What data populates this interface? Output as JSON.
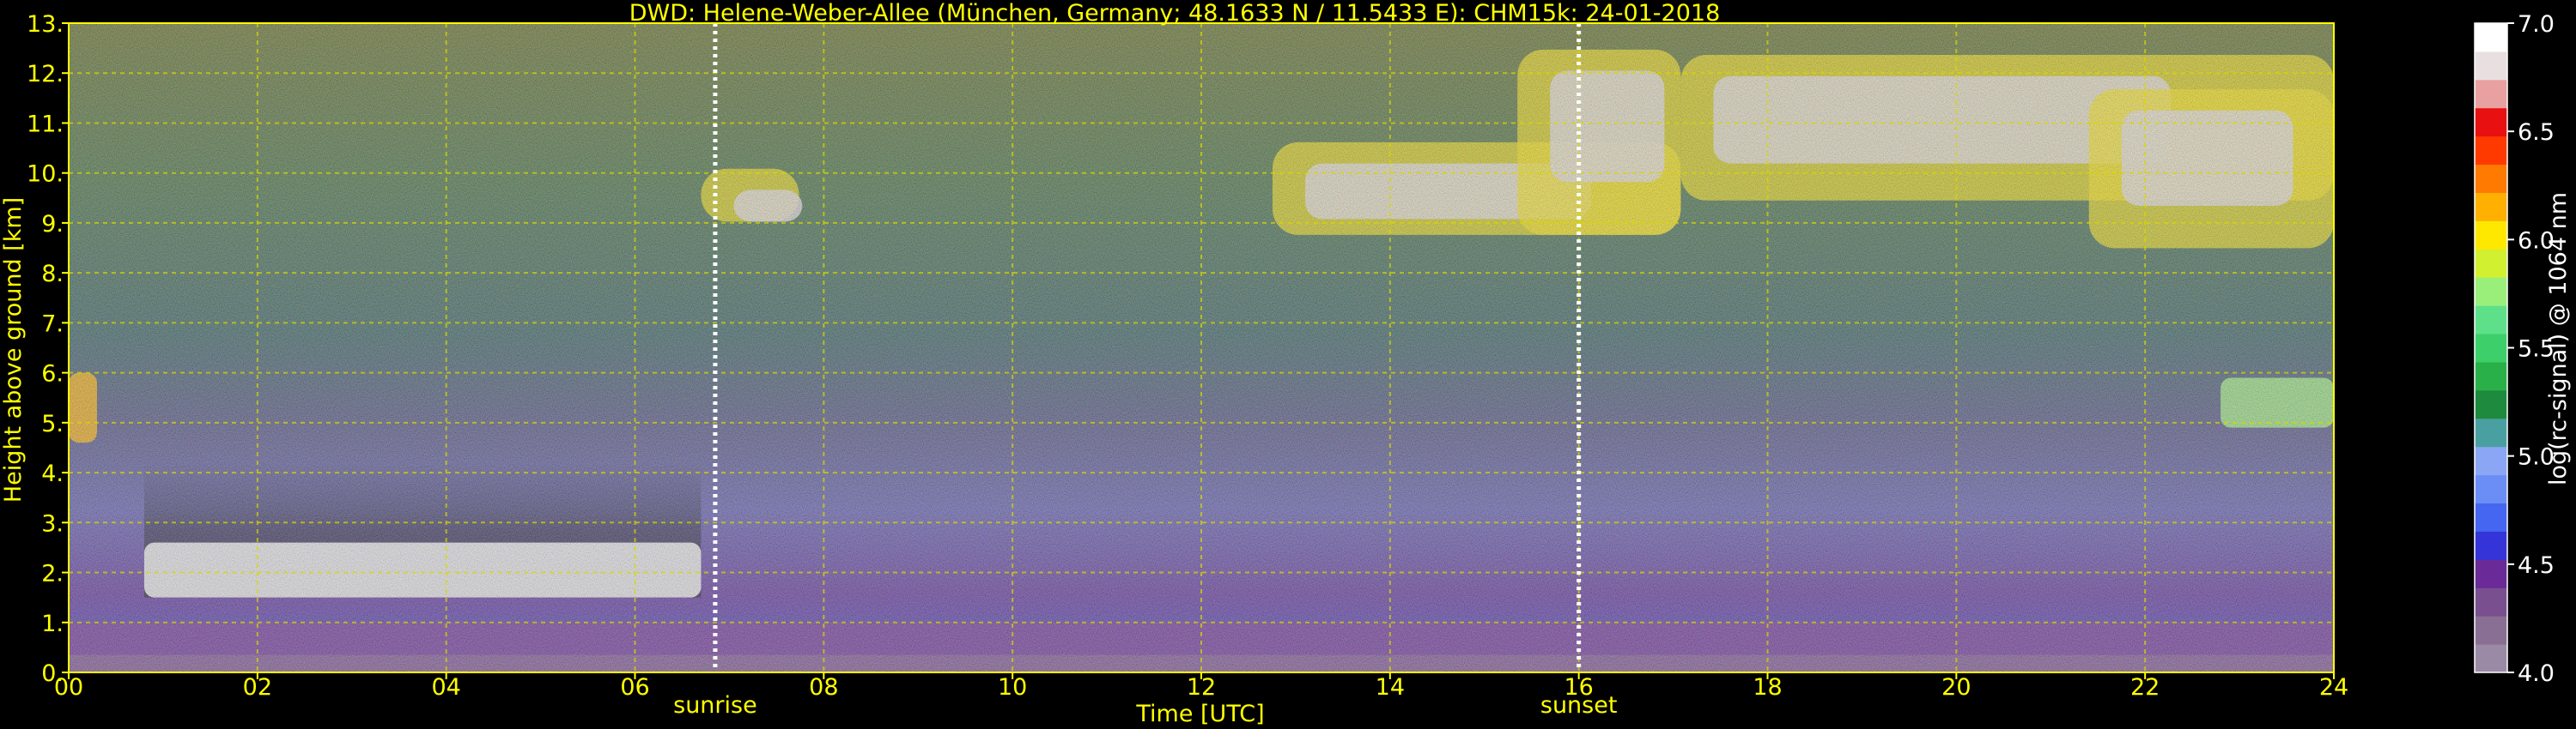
{
  "chart_data": {
    "type": "heatmap",
    "title": "DWD: Helene-Weber-Allee (München, Germany; 48.1633 N / 11.5433 E):    CHM15k: 24-01-2018",
    "xlabel": "Time [UTC]",
    "ylabel": "Height above ground [km]",
    "xlim": [
      0,
      24
    ],
    "ylim": [
      0,
      13
    ],
    "x_ticks": [
      {
        "value": 0,
        "label": "00"
      },
      {
        "value": 2,
        "label": "02"
      },
      {
        "value": 4,
        "label": "04"
      },
      {
        "value": 6,
        "label": "06"
      },
      {
        "value": 8,
        "label": "08"
      },
      {
        "value": 10,
        "label": "10"
      },
      {
        "value": 12,
        "label": "12"
      },
      {
        "value": 14,
        "label": "14"
      },
      {
        "value": 16,
        "label": "16"
      },
      {
        "value": 18,
        "label": "18"
      },
      {
        "value": 20,
        "label": "20"
      },
      {
        "value": 22,
        "label": "22"
      },
      {
        "value": 24,
        "label": "24"
      }
    ],
    "y_ticks": [
      {
        "value": 0,
        "label": "0."
      },
      {
        "value": 1,
        "label": "1."
      },
      {
        "value": 2,
        "label": "2."
      },
      {
        "value": 3,
        "label": "3."
      },
      {
        "value": 4,
        "label": "4."
      },
      {
        "value": 5,
        "label": "5."
      },
      {
        "value": 6,
        "label": "6."
      },
      {
        "value": 7,
        "label": "7."
      },
      {
        "value": 8,
        "label": "8."
      },
      {
        "value": 9,
        "label": "9."
      },
      {
        "value": 10,
        "label": "10."
      },
      {
        "value": 11,
        "label": "11."
      },
      {
        "value": 12,
        "label": "12."
      },
      {
        "value": 13,
        "label": "13."
      }
    ],
    "grid": true,
    "markers": [
      {
        "value": 6.85,
        "label": "sunrise"
      },
      {
        "value": 16.0,
        "label": "sunset"
      }
    ],
    "colorbar": {
      "label": "log(rc-signal) @ 1064 nm",
      "range": [
        4.0,
        7.0
      ],
      "ticks": [
        {
          "value": 4.0,
          "label": "4.0"
        },
        {
          "value": 4.5,
          "label": "4.5"
        },
        {
          "value": 5.0,
          "label": "5.0"
        },
        {
          "value": 5.5,
          "label": "5.5"
        },
        {
          "value": 6.0,
          "label": "6.0"
        },
        {
          "value": 6.5,
          "label": "6.5"
        },
        {
          "value": 7.0,
          "label": "7.0"
        }
      ],
      "colors": [
        "#9a8aa6",
        "#8a6f94",
        "#7a4f90",
        "#6a2a98",
        "#3434d8",
        "#4466f0",
        "#6a8ef5",
        "#8aa6f5",
        "#4aa0a0",
        "#1e8a3e",
        "#2ab048",
        "#3ccf6a",
        "#5ee08a",
        "#9aef7a",
        "#d0f030",
        "#ffe800",
        "#ffb000",
        "#ff7a00",
        "#ff3a00",
        "#e81010",
        "#e8a0a0",
        "#e8e0e0",
        "#ffffff"
      ]
    },
    "features": [
      {
        "name": "boundary layer",
        "x_range": [
          0,
          24
        ],
        "y_range": [
          0,
          1.0
        ],
        "level": 4.45
      },
      {
        "name": "low cloud",
        "x_range": [
          0.8,
          6.7
        ],
        "y_range": [
          1.5,
          2.6
        ],
        "level": 7.0
      },
      {
        "name": "mid-level cloud",
        "x_range": [
          0,
          0.3
        ],
        "y_range": [
          4.6,
          6.0
        ],
        "level": 6.1
      },
      {
        "name": "mid-level cloud",
        "x_range": [
          22.8,
          24
        ],
        "y_range": [
          4.9,
          5.9
        ],
        "level": 5.7
      },
      {
        "name": "cirrus",
        "x_range": [
          6.7,
          24
        ],
        "y_range": [
          7.7,
          13
        ],
        "level": 6.8
      }
    ]
  }
}
